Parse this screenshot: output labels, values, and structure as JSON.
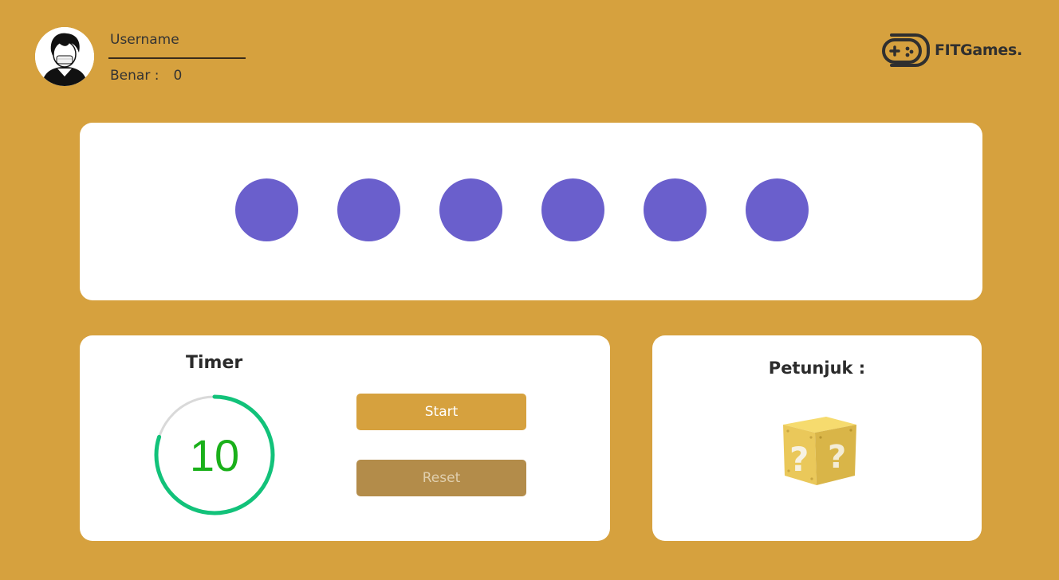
{
  "header": {
    "username": "Username",
    "score_label": "Benar :",
    "score_value": "0",
    "brand": "FITGames."
  },
  "sequence": {
    "dots": [
      "#6A5FCC",
      "#6A5FCC",
      "#6A5FCC",
      "#6A5FCC",
      "#6A5FCC",
      "#6A5FCC"
    ]
  },
  "timer": {
    "title": "Timer",
    "value": "10",
    "progress": 0.8,
    "start_label": "Start",
    "reset_label": "Reset"
  },
  "hint": {
    "title": "Petunjuk :",
    "icon": "mystery-box-icon"
  },
  "colors": {
    "background": "#D6A13E",
    "dot": "#6A5FCC",
    "timer_text": "#1AB01A",
    "ring": "#12C27A"
  }
}
